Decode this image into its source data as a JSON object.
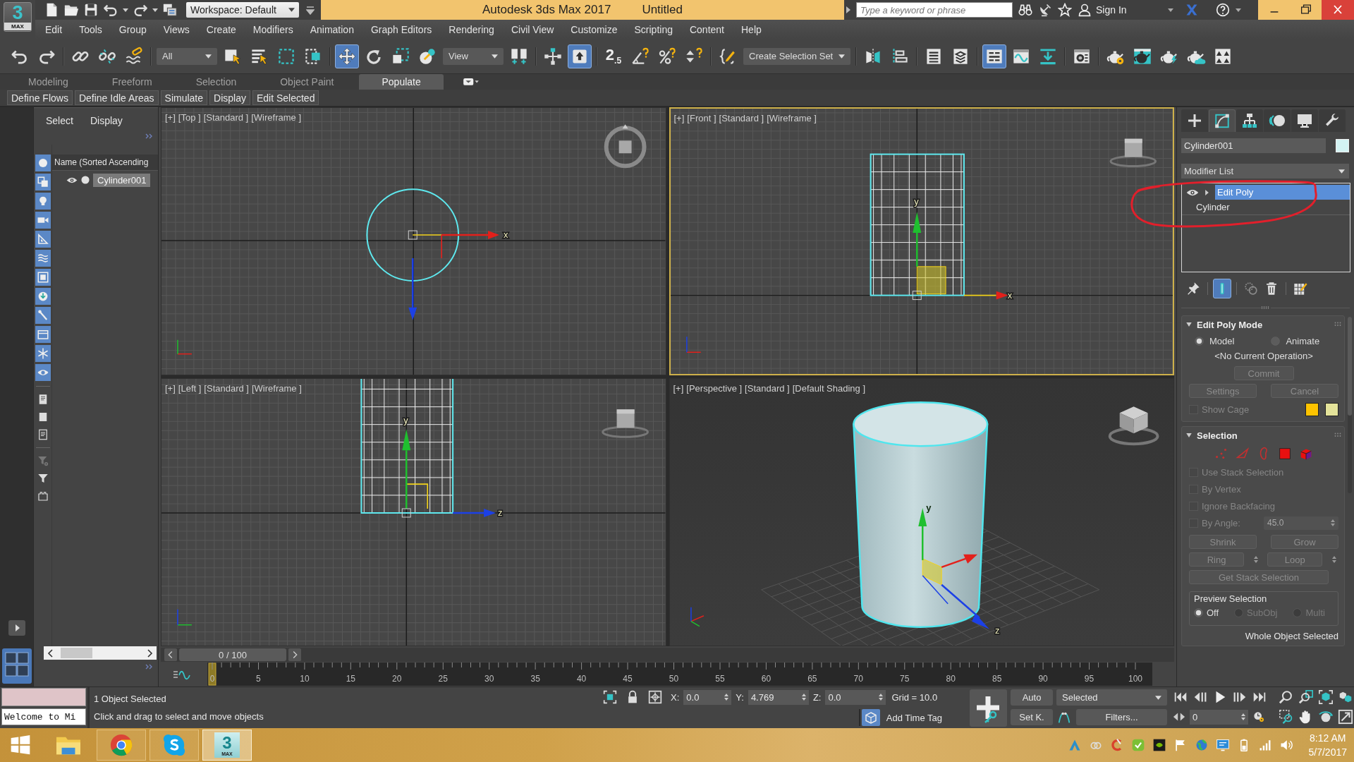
{
  "app_menu": {
    "numeral": "3",
    "caption": "MAX"
  },
  "title_bar": {
    "workspace": "Workspace: Default",
    "app_title": "Autodesk 3ds Max 2017",
    "document_title": "Untitled",
    "search": {
      "placeholder": "Type a keyword or phrase"
    },
    "sign_in": "Sign In"
  },
  "menu_bar": [
    "Edit",
    "Tools",
    "Group",
    "Views",
    "Create",
    "Modifiers",
    "Animation",
    "Graph Editors",
    "Rendering",
    "Civil View",
    "Customize",
    "Scripting",
    "Content",
    "Help"
  ],
  "main_toolbar": [
    {
      "kind": "button",
      "selected": false
    },
    {
      "kind": "button",
      "selected": false
    },
    {
      "kind": "button",
      "selected": false
    },
    {
      "kind": "button",
      "selected": false
    },
    {
      "kind": "button",
      "selected": false
    },
    {
      "kind": "dropdown",
      "value": "All"
    },
    {
      "kind": "button",
      "selected": false
    },
    {
      "kind": "button",
      "selected": false
    },
    {
      "kind": "button",
      "selected": false
    },
    {
      "kind": "button",
      "selected": false
    },
    {
      "kind": "button",
      "selected": true
    },
    {
      "kind": "button",
      "selected": false
    },
    {
      "kind": "button",
      "selected": false
    },
    {
      "kind": "button",
      "selected": false
    },
    {
      "kind": "dropdown",
      "value": "View"
    },
    {
      "kind": "button",
      "selected": false
    },
    {
      "kind": "button",
      "selected": false
    },
    {
      "kind": "button",
      "selected": true
    },
    {
      "kind": "snap",
      "label": "2$_{.5}$",
      "selected": false
    },
    {
      "kind": "button",
      "selected": false
    },
    {
      "kind": "button",
      "selected": false
    },
    {
      "kind": "button",
      "selected": false
    },
    {
      "kind": "button",
      "selected": false
    },
    {
      "kind": "dropdown",
      "value": "Create Selection Set"
    },
    {
      "kind": "button",
      "selected": false
    },
    {
      "kind": "button",
      "selected": false
    },
    {
      "kind": "button",
      "selected": false
    },
    {
      "kind": "button",
      "selected": false
    },
    {
      "kind": "button",
      "selected": true
    },
    {
      "kind": "button",
      "selected": false
    },
    {
      "kind": "button",
      "selected": false
    },
    {
      "kind": "button",
      "selected": false
    },
    {
      "kind": "button",
      "selected": false
    },
    {
      "kind": "button",
      "selected": false
    },
    {
      "kind": "button",
      "selected": false
    },
    {
      "kind": "button",
      "selected": false
    },
    {
      "kind": "button",
      "selected": false
    }
  ],
  "ribbon": {
    "tabs": [
      {
        "label": "Modeling",
        "selected": false
      },
      {
        "label": "Freeform",
        "selected": false
      },
      {
        "label": "Selection",
        "selected": false
      },
      {
        "label": "Object Paint",
        "selected": false
      },
      {
        "label": "Populate",
        "selected": true
      }
    ],
    "panels": [
      "Define Flows",
      "Define Idle Areas",
      "Simulate",
      "Display",
      "Edit Selected"
    ]
  },
  "scene_explorer": {
    "menus": [
      "Select",
      "Display"
    ],
    "filters": [
      {
        "on": true
      },
      {
        "on": true
      },
      {
        "on": true
      },
      {
        "on": true
      },
      {
        "on": true
      },
      {
        "on": true
      },
      {
        "on": true
      },
      {
        "on": true
      },
      {
        "on": true
      },
      {
        "on": true
      },
      {
        "on": true
      },
      {
        "on": true
      }
    ],
    "column": "Name (Sorted Ascending",
    "objects": [
      {
        "name": "Cylinder001",
        "selected": true
      }
    ]
  },
  "viewports": [
    {
      "kind": "top",
      "active": false,
      "labels": [
        "[+]",
        "[Top ]",
        "[Standard ]",
        "[Wireframe ]"
      ],
      "axis_labels": [
        "x"
      ]
    },
    {
      "kind": "front",
      "active": true,
      "labels": [
        "[+]",
        "[Front ]",
        "[Standard ]",
        "[Wireframe ]"
      ],
      "axis_labels": [
        "y",
        "x"
      ]
    },
    {
      "kind": "left",
      "active": false,
      "labels": [
        "[+]",
        "[Left ]",
        "[Standard ]",
        "[Wireframe ]"
      ],
      "axis_labels": [
        "y",
        "z"
      ]
    },
    {
      "kind": "perspective",
      "active": false,
      "labels": [
        "[+]",
        "[Perspective ]",
        "[Standard ]",
        "[Default Shading ]"
      ],
      "axis_labels": [
        "y",
        "z"
      ]
    }
  ],
  "command_panel": {
    "tabs": [
      {
        "selected": false
      },
      {
        "selected": true
      },
      {
        "selected": false
      },
      {
        "selected": false
      },
      {
        "selected": false
      },
      {
        "selected": false
      }
    ],
    "object_name": "Cylinder001",
    "modifier_list": "Modifier List",
    "stack": [
      {
        "name": "Edit Poly",
        "kind": "modifier",
        "selected": true
      },
      {
        "name": "Cylinder",
        "kind": "base",
        "selected": false
      }
    ],
    "stack_tools": [
      {
        "selected": false
      },
      {
        "selected": true
      },
      {
        "selected": false
      },
      {
        "selected": false
      },
      {
        "selected": false
      }
    ],
    "rollouts": [
      {
        "kind": "edit_poly_mode",
        "title": "Edit Poly Mode",
        "expanded": true,
        "modes": [
          {
            "label": "Model",
            "selected": true
          },
          {
            "label": "Animate",
            "selected": false
          }
        ],
        "operation": "<No Current Operation>",
        "commit": {
          "label": "Commit",
          "disabled": true
        },
        "buttons": [
          {
            "label": "Settings",
            "disabled": true
          },
          {
            "label": "Cancel",
            "disabled": true
          }
        ],
        "show_cage": {
          "label": "Show Cage",
          "checked": false,
          "disabled": true
        },
        "cage_colors": [
          {
            "color": "#fdc300"
          },
          {
            "color": "#e4e39a"
          }
        ]
      },
      {
        "kind": "selection",
        "title": "Selection",
        "expanded": true,
        "levels": [
          {
            "selected": false
          },
          {
            "selected": false
          },
          {
            "selected": false
          },
          {
            "selected": false
          },
          {
            "selected": false
          }
        ],
        "options": [
          {
            "label": "Use Stack Selection",
            "checked": false,
            "disabled": true
          },
          {
            "label": "By Vertex",
            "checked": false,
            "disabled": true
          },
          {
            "label": "Ignore Backfacing",
            "checked": false,
            "disabled": true
          }
        ],
        "angle": {
          "label": "By Angle:",
          "checked": false,
          "disabled": true,
          "value": "45.0"
        },
        "grow_shrink": [
          {
            "label": "Shrink",
            "disabled": true
          },
          {
            "label": "Grow",
            "disabled": true
          }
        ],
        "ring_loop": [
          {
            "label": "Ring",
            "disabled": true
          },
          {
            "label": "Loop",
            "disabled": true
          }
        ],
        "get_stack": {
          "label": "Get Stack Selection",
          "disabled": true
        },
        "preview": {
          "title": "Preview Selection",
          "options": [
            {
              "label": "Off",
              "selected": true,
              "disabled": false
            },
            {
              "label": "SubObj",
              "selected": false,
              "disabled": true
            },
            {
              "label": "Multi",
              "selected": false,
              "disabled": true
            }
          ]
        },
        "status": "Whole Object Selected"
      }
    ]
  },
  "time_slider": {
    "position": "0 / 100",
    "level": 0
  },
  "track_bar": {
    "labels": [
      "0",
      "5",
      "10",
      "15",
      "20",
      "25",
      "30",
      "35",
      "40",
      "45",
      "50",
      "55",
      "60",
      "65",
      "70",
      "75",
      "80",
      "85",
      "90",
      "95",
      "100"
    ],
    "level": 0
  },
  "status_bar": {
    "listener_output": "Welcome to Mi",
    "selection": "1 Object Selected",
    "prompt": "Click and drag to select and move objects",
    "coordinates": [
      {
        "axis": "X:",
        "value": "0.0"
      },
      {
        "axis": "Y:",
        "value": "4.769"
      },
      {
        "axis": "Z:",
        "value": "0.0"
      }
    ],
    "grid": "Grid = 10.0",
    "time_tag": "Add Time Tag"
  },
  "animation_controls": {
    "auto_key": {
      "label": "Auto",
      "on": false
    },
    "set_key_mode": {
      "label": "Set K.",
      "on": false
    },
    "key_set": "Selected",
    "filters": "Filters...",
    "frame": "0"
  },
  "taskbar": {
    "apps": [
      {
        "kind": "explorer",
        "running": false,
        "selected": false
      },
      {
        "kind": "chrome",
        "running": true,
        "selected": false
      },
      {
        "kind": "skype",
        "running": true,
        "selected": false
      },
      {
        "kind": "max",
        "running": true,
        "selected": true,
        "glyph": "3",
        "caption": "MAX"
      }
    ],
    "time": "8:12 AM",
    "date": "5/7/2017"
  }
}
